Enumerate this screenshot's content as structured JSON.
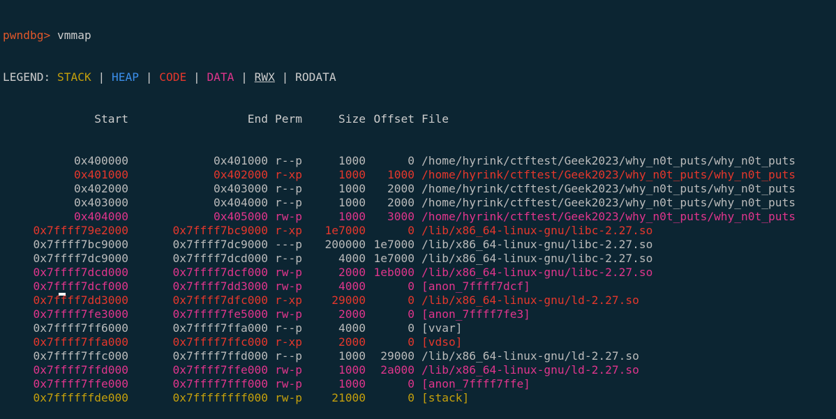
{
  "prompt": {
    "label": "pwndbg>",
    "command": "vmmap"
  },
  "legend": {
    "label": "LEGEND:",
    "stack": "STACK",
    "heap": "HEAP",
    "code": "CODE",
    "data": "DATA",
    "rwx": "RWX",
    "rodata": "RODATA",
    "separator": "|"
  },
  "colors": {
    "background": "#0c2532",
    "prompt": "#e0572a",
    "stack": "#c5a00c",
    "heap": "#3b8eea",
    "code": "#e5372c",
    "data": "#e0358c",
    "plain": "#cccccc"
  },
  "headers": {
    "start": "Start",
    "end": "End",
    "perm": "Perm",
    "size": "Size",
    "offset": "Offset",
    "file": "File"
  },
  "rows": [
    {
      "kind": "ro",
      "start": "0x400000",
      "end": "0x401000",
      "perm": "r--p",
      "size": "1000",
      "offset": "0",
      "file": "/home/hyrink/ctftest/Geek2023/why_n0t_puts/why_n0t_puts"
    },
    {
      "kind": "code",
      "start": "0x401000",
      "end": "0x402000",
      "perm": "r-xp",
      "size": "1000",
      "offset": "1000",
      "file": "/home/hyrink/ctftest/Geek2023/why_n0t_puts/why_n0t_puts"
    },
    {
      "kind": "ro",
      "start": "0x402000",
      "end": "0x403000",
      "perm": "r--p",
      "size": "1000",
      "offset": "2000",
      "file": "/home/hyrink/ctftest/Geek2023/why_n0t_puts/why_n0t_puts"
    },
    {
      "kind": "ro",
      "start": "0x403000",
      "end": "0x404000",
      "perm": "r--p",
      "size": "1000",
      "offset": "2000",
      "file": "/home/hyrink/ctftest/Geek2023/why_n0t_puts/why_n0t_puts"
    },
    {
      "kind": "data",
      "start": "0x404000",
      "end": "0x405000",
      "perm": "rw-p",
      "size": "1000",
      "offset": "3000",
      "file": "/home/hyrink/ctftest/Geek2023/why_n0t_puts/why_n0t_puts"
    },
    {
      "kind": "code",
      "start": "0x7ffff79e2000",
      "end": "0x7ffff7bc9000",
      "perm": "r-xp",
      "size": "1e7000",
      "offset": "0",
      "file": "/lib/x86_64-linux-gnu/libc-2.27.so"
    },
    {
      "kind": "ro",
      "start": "0x7ffff7bc9000",
      "end": "0x7ffff7dc9000",
      "perm": "---p",
      "size": "200000",
      "offset": "1e7000",
      "file": "/lib/x86_64-linux-gnu/libc-2.27.so"
    },
    {
      "kind": "ro",
      "start": "0x7ffff7dc9000",
      "end": "0x7ffff7dcd000",
      "perm": "r--p",
      "size": "4000",
      "offset": "1e7000",
      "file": "/lib/x86_64-linux-gnu/libc-2.27.so"
    },
    {
      "kind": "data",
      "start": "0x7ffff7dcd000",
      "end": "0x7ffff7dcf000",
      "perm": "rw-p",
      "size": "2000",
      "offset": "1eb000",
      "file": "/lib/x86_64-linux-gnu/libc-2.27.so"
    },
    {
      "kind": "data",
      "start": "0x7ffff7dcf000",
      "end": "0x7ffff7dd3000",
      "perm": "rw-p",
      "size": "4000",
      "offset": "0",
      "file": "[anon_7ffff7dcf]"
    },
    {
      "kind": "code",
      "start": "0x7ffff7dd3000",
      "end": "0x7ffff7dfc000",
      "perm": "r-xp",
      "size": "29000",
      "offset": "0",
      "file": "/lib/x86_64-linux-gnu/ld-2.27.so"
    },
    {
      "kind": "data",
      "start": "0x7ffff7fe3000",
      "end": "0x7ffff7fe5000",
      "perm": "rw-p",
      "size": "2000",
      "offset": "0",
      "file": "[anon_7ffff7fe3]"
    },
    {
      "kind": "ro",
      "start": "0x7ffff7ff6000",
      "end": "0x7ffff7ffa000",
      "perm": "r--p",
      "size": "4000",
      "offset": "0",
      "file": "[vvar]"
    },
    {
      "kind": "code",
      "start": "0x7ffff7ffa000",
      "end": "0x7ffff7ffc000",
      "perm": "r-xp",
      "size": "2000",
      "offset": "0",
      "file": "[vdso]"
    },
    {
      "kind": "ro",
      "start": "0x7ffff7ffc000",
      "end": "0x7ffff7ffd000",
      "perm": "r--p",
      "size": "1000",
      "offset": "29000",
      "file": "/lib/x86_64-linux-gnu/ld-2.27.so"
    },
    {
      "kind": "data",
      "start": "0x7ffff7ffd000",
      "end": "0x7ffff7ffe000",
      "perm": "rw-p",
      "size": "1000",
      "offset": "2a000",
      "file": "/lib/x86_64-linux-gnu/ld-2.27.so"
    },
    {
      "kind": "data",
      "start": "0x7ffff7ffe000",
      "end": "0x7ffff7fff000",
      "perm": "rw-p",
      "size": "1000",
      "offset": "0",
      "file": "[anon_7ffff7ffe]"
    },
    {
      "kind": "stack",
      "start": "0x7ffffffde000",
      "end": "0x7ffffffff000",
      "perm": "rw-p",
      "size": "21000",
      "offset": "0",
      "file": "[stack]"
    }
  ]
}
